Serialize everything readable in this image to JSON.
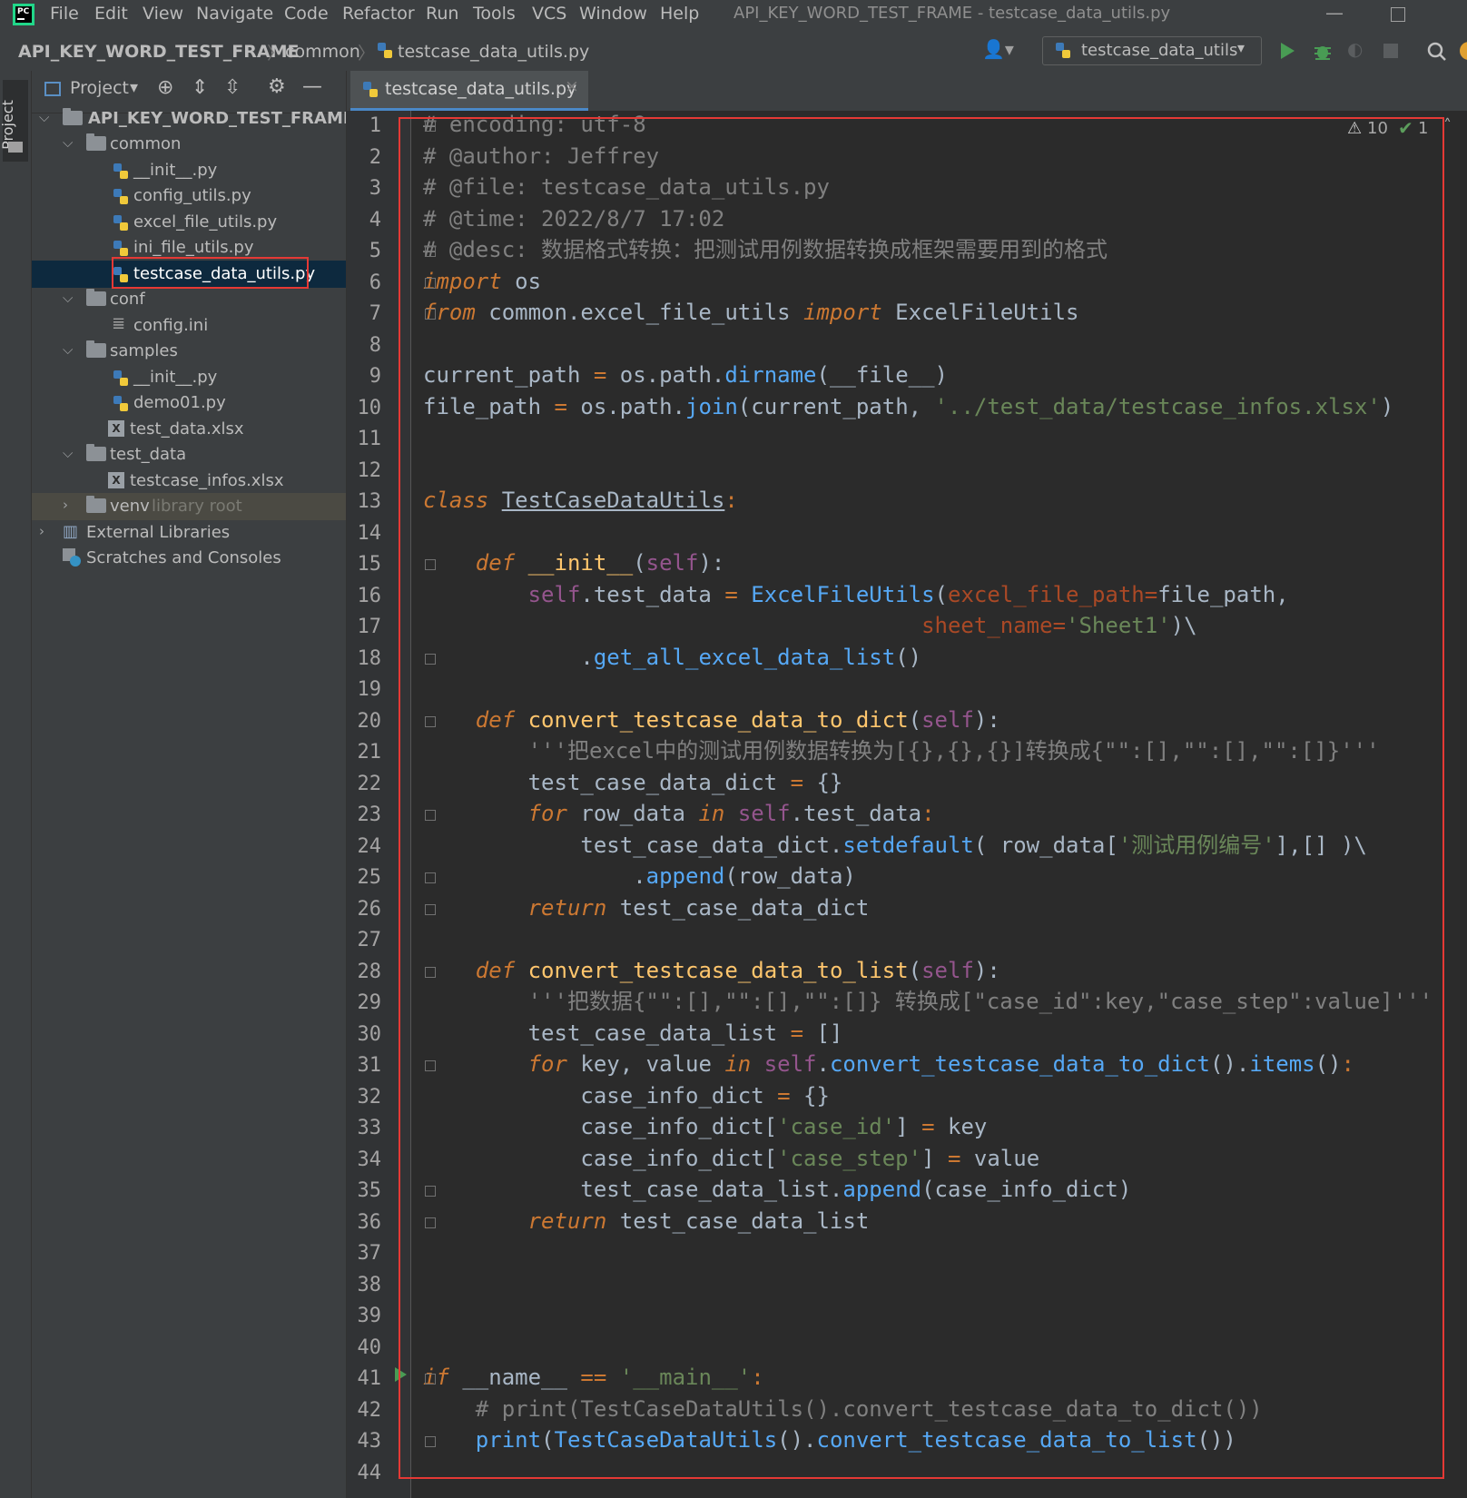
{
  "menubar": {
    "items": [
      "File",
      "Edit",
      "View",
      "Navigate",
      "Code",
      "Refactor",
      "Run",
      "Tools",
      "VCS",
      "Window",
      "Help"
    ],
    "window_title": "API_KEY_WORD_TEST_FRAME - testcase_data_utils.py"
  },
  "navbar": {
    "breadcrumbs": [
      "API_KEY_WORD_TEST_FRAME",
      "common",
      "testcase_data_utils.py"
    ],
    "run_config": "testcase_data_utils"
  },
  "stripe": {
    "project_label": "Project"
  },
  "project_panel": {
    "title": "Project",
    "tree": [
      {
        "label": "API_KEY_WORD_TEST_FRAME",
        "type": "folder",
        "depth": 0,
        "expanded": true
      },
      {
        "label": "common",
        "type": "folder",
        "depth": 1,
        "expanded": true
      },
      {
        "label": "__init__.py",
        "type": "py",
        "depth": 2
      },
      {
        "label": "config_utils.py",
        "type": "py",
        "depth": 2
      },
      {
        "label": "excel_file_utils.py",
        "type": "py",
        "depth": 2
      },
      {
        "label": "ini_file_utils.py",
        "type": "py",
        "depth": 2
      },
      {
        "label": "testcase_data_utils.py",
        "type": "py",
        "depth": 2,
        "selected": true
      },
      {
        "label": "conf",
        "type": "folder",
        "depth": 1,
        "expanded": true
      },
      {
        "label": "config.ini",
        "type": "ini",
        "depth": 2
      },
      {
        "label": "samples",
        "type": "folder",
        "depth": 1,
        "expanded": true
      },
      {
        "label": "__init__.py",
        "type": "py",
        "depth": 2
      },
      {
        "label": "demo01.py",
        "type": "py",
        "depth": 2
      },
      {
        "label": "test_data.xlsx",
        "type": "xlsx",
        "depth": 2
      },
      {
        "label": "test_data",
        "type": "folder",
        "depth": 1,
        "expanded": true
      },
      {
        "label": "testcase_infos.xlsx",
        "type": "xlsx",
        "depth": 2
      },
      {
        "label": "venv",
        "type": "folder",
        "depth": 1,
        "expanded": false,
        "suffix": "library root"
      },
      {
        "label": "External Libraries",
        "type": "lib",
        "depth": 0,
        "expanded": false
      },
      {
        "label": "Scratches and Consoles",
        "type": "scratch",
        "depth": 0
      }
    ]
  },
  "editor": {
    "tab_label": "testcase_data_utils.py",
    "warnings": "10",
    "checks": "1",
    "line_numbers": [
      "1",
      "2",
      "3",
      "4",
      "5",
      "6",
      "7",
      "8",
      "9",
      "10",
      "11",
      "12",
      "13",
      "14",
      "15",
      "16",
      "17",
      "18",
      "19",
      "20",
      "21",
      "22",
      "23",
      "24",
      "25",
      "26",
      "27",
      "28",
      "29",
      "30",
      "31",
      "32",
      "33",
      "34",
      "35",
      "36",
      "37",
      "38",
      "39",
      "40",
      "41",
      "42",
      "43",
      "44"
    ],
    "code": {
      "l1": "# encoding: utf-8",
      "l2": "# @author: Jeffrey",
      "l3": "# @file: testcase_data_utils.py",
      "l4": "# @time: 2022/8/7 17:02",
      "l5": "# @desc: 数据格式转换：把测试用例数据转换成框架需要用到的格式",
      "l6a": "import",
      "l6b": " os",
      "l7a": "from",
      "l7b": " common.excel_file_utils ",
      "l7c": "import",
      "l7d": " ExcelFileUtils",
      "l9a": "current_path ",
      "l9b": "=",
      "l9c": " os.path.",
      "l9d": "dirname",
      "l9e": "(__file__)",
      "l10a": "file_path ",
      "l10b": "=",
      "l10c": " os.path.",
      "l10d": "join",
      "l10e": "(current_path, ",
      "l10f": "'../test_data/testcase_infos.xlsx'",
      "l10g": ")",
      "l13a": "class",
      "l13b": " ",
      "l13c": "TestCaseDataUtils",
      "l13d": ":",
      "l15a": "    ",
      "l15b": "def",
      "l15c": " ",
      "l15d": "__init__",
      "l15e": "(",
      "l15f": "self",
      "l15g": "):",
      "l16a": "        ",
      "l16b": "self",
      "l16c": ".test_data ",
      "l16d": "=",
      "l16e": " ",
      "l16f": "ExcelFileUtils",
      "l16g": "(",
      "l16h": "excel_file_path=",
      "l16i": "file_path,",
      "l17a": "                                      ",
      "l17b": "sheet_name=",
      "l17c": "'Sheet1'",
      "l17d": ")\\",
      "l18a": "            .",
      "l18b": "get_all_excel_data_list",
      "l18c": "()",
      "l20a": "    ",
      "l20b": "def",
      "l20c": " ",
      "l20d": "convert_testcase_data_to_dict",
      "l20e": "(",
      "l20f": "self",
      "l20g": "):",
      "l21": "        '''把excel中的测试用例数据转换为[{},{},{}]转换成{\"\":[],\"\":[],\"\":[]}'''",
      "l22a": "        test_case_data_dict ",
      "l22b": "=",
      "l22c": " {}",
      "l23a": "        ",
      "l23b": "for",
      "l23c": " row_data ",
      "l23d": "in",
      "l23e": " ",
      "l23f": "self",
      "l23g": ".test_data",
      "l23h": ":",
      "l24a": "            test_case_data_dict.",
      "l24b": "setdefault",
      "l24c": "( row_data[",
      "l24d": "'测试用例编号'",
      "l24e": "],[] )\\",
      "l25a": "                .",
      "l25b": "append",
      "l25c": "(row_data)",
      "l26a": "        ",
      "l26b": "return",
      "l26c": " test_case_data_dict",
      "l28a": "    ",
      "l28b": "def",
      "l28c": " ",
      "l28d": "convert_testcase_data_to_list",
      "l28e": "(",
      "l28f": "self",
      "l28g": "):",
      "l29": "        '''把数据{\"\":[],\"\":[],\"\":[]} 转换成[\"case_id\":key,\"case_step\":value]'''",
      "l30a": "        test_case_data_list ",
      "l30b": "=",
      "l30c": " []",
      "l31a": "        ",
      "l31b": "for",
      "l31c": " key, value ",
      "l31d": "in",
      "l31e": " ",
      "l31f": "self",
      "l31g": ".",
      "l31h": "convert_testcase_data_to_dict",
      "l31i": "().",
      "l31j": "items",
      "l31k": "()",
      "l31l": ":",
      "l32a": "            case_info_dict ",
      "l32b": "=",
      "l32c": " {}",
      "l33a": "            case_info_dict[",
      "l33b": "'case_id'",
      "l33c": "] ",
      "l33d": "=",
      "l33e": " key",
      "l34a": "            case_info_dict[",
      "l34b": "'case_step'",
      "l34c": "] ",
      "l34d": "=",
      "l34e": " value",
      "l35a": "            test_case_data_list.",
      "l35b": "append",
      "l35c": "(case_info_dict)",
      "l36a": "        ",
      "l36b": "return",
      "l36c": " test_case_data_list",
      "l41a": "if",
      "l41b": " __name__ ",
      "l41c": "==",
      "l41d": " ",
      "l41e": "'__main__'",
      "l41f": ":",
      "l42": "    # print(TestCaseDataUtils().convert_testcase_data_to_dict())",
      "l43a": "    ",
      "l43b": "print",
      "l43c": "(",
      "l43d": "TestCaseDataUtils",
      "l43e": "().",
      "l43f": "convert_testcase_data_to_list",
      "l43g": "())"
    }
  },
  "colors": {
    "highlight": "#e53935",
    "selection": "#0d293e",
    "accent_tab": "#4a88c7"
  }
}
